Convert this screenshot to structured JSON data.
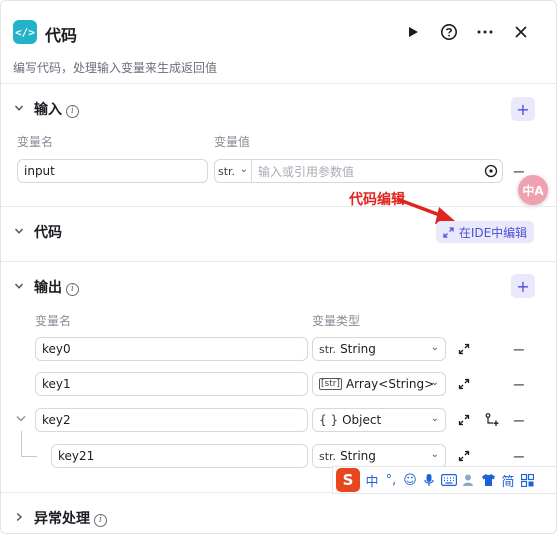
{
  "header": {
    "app_icon": "</>",
    "title": "代码",
    "subtitle": "编写代码，处理输入变量来生成返回值",
    "icons": [
      "play-icon",
      "help-icon",
      "more-icon",
      "close-icon"
    ]
  },
  "input_section": {
    "title": "输入",
    "col_name": "变量名",
    "col_value": "变量值",
    "row": {
      "name": "input",
      "type": "str.",
      "value_placeholder": "输入或引用参数值"
    }
  },
  "code_section": {
    "title": "代码",
    "ide_button": "在IDE中编辑",
    "annotation": "代码编辑"
  },
  "output_section": {
    "title": "输出",
    "col_name": "变量名",
    "col_type": "变量类型",
    "rows": [
      {
        "name": "key0",
        "tag": "str.",
        "type": "String"
      },
      {
        "name": "key1",
        "tag": "[str]",
        "type": "Array<String>"
      },
      {
        "name": "key2",
        "tag": "{ }",
        "type": "Object"
      },
      {
        "name": "key21",
        "tag": "str.",
        "type": "String"
      }
    ]
  },
  "error_section": {
    "title": "异常处理"
  },
  "translate_fab": "中A",
  "ime": {
    "logo": "S",
    "items": [
      "中",
      "°,",
      "☺",
      "🎤",
      "⌨",
      "👤",
      "👕",
      "简",
      "▦"
    ]
  },
  "colors": {
    "accent": "#4e4fd8",
    "accent_bg": "#e9e9fb",
    "app_icon": "#23b3c9",
    "annotation": "#e0241f"
  }
}
